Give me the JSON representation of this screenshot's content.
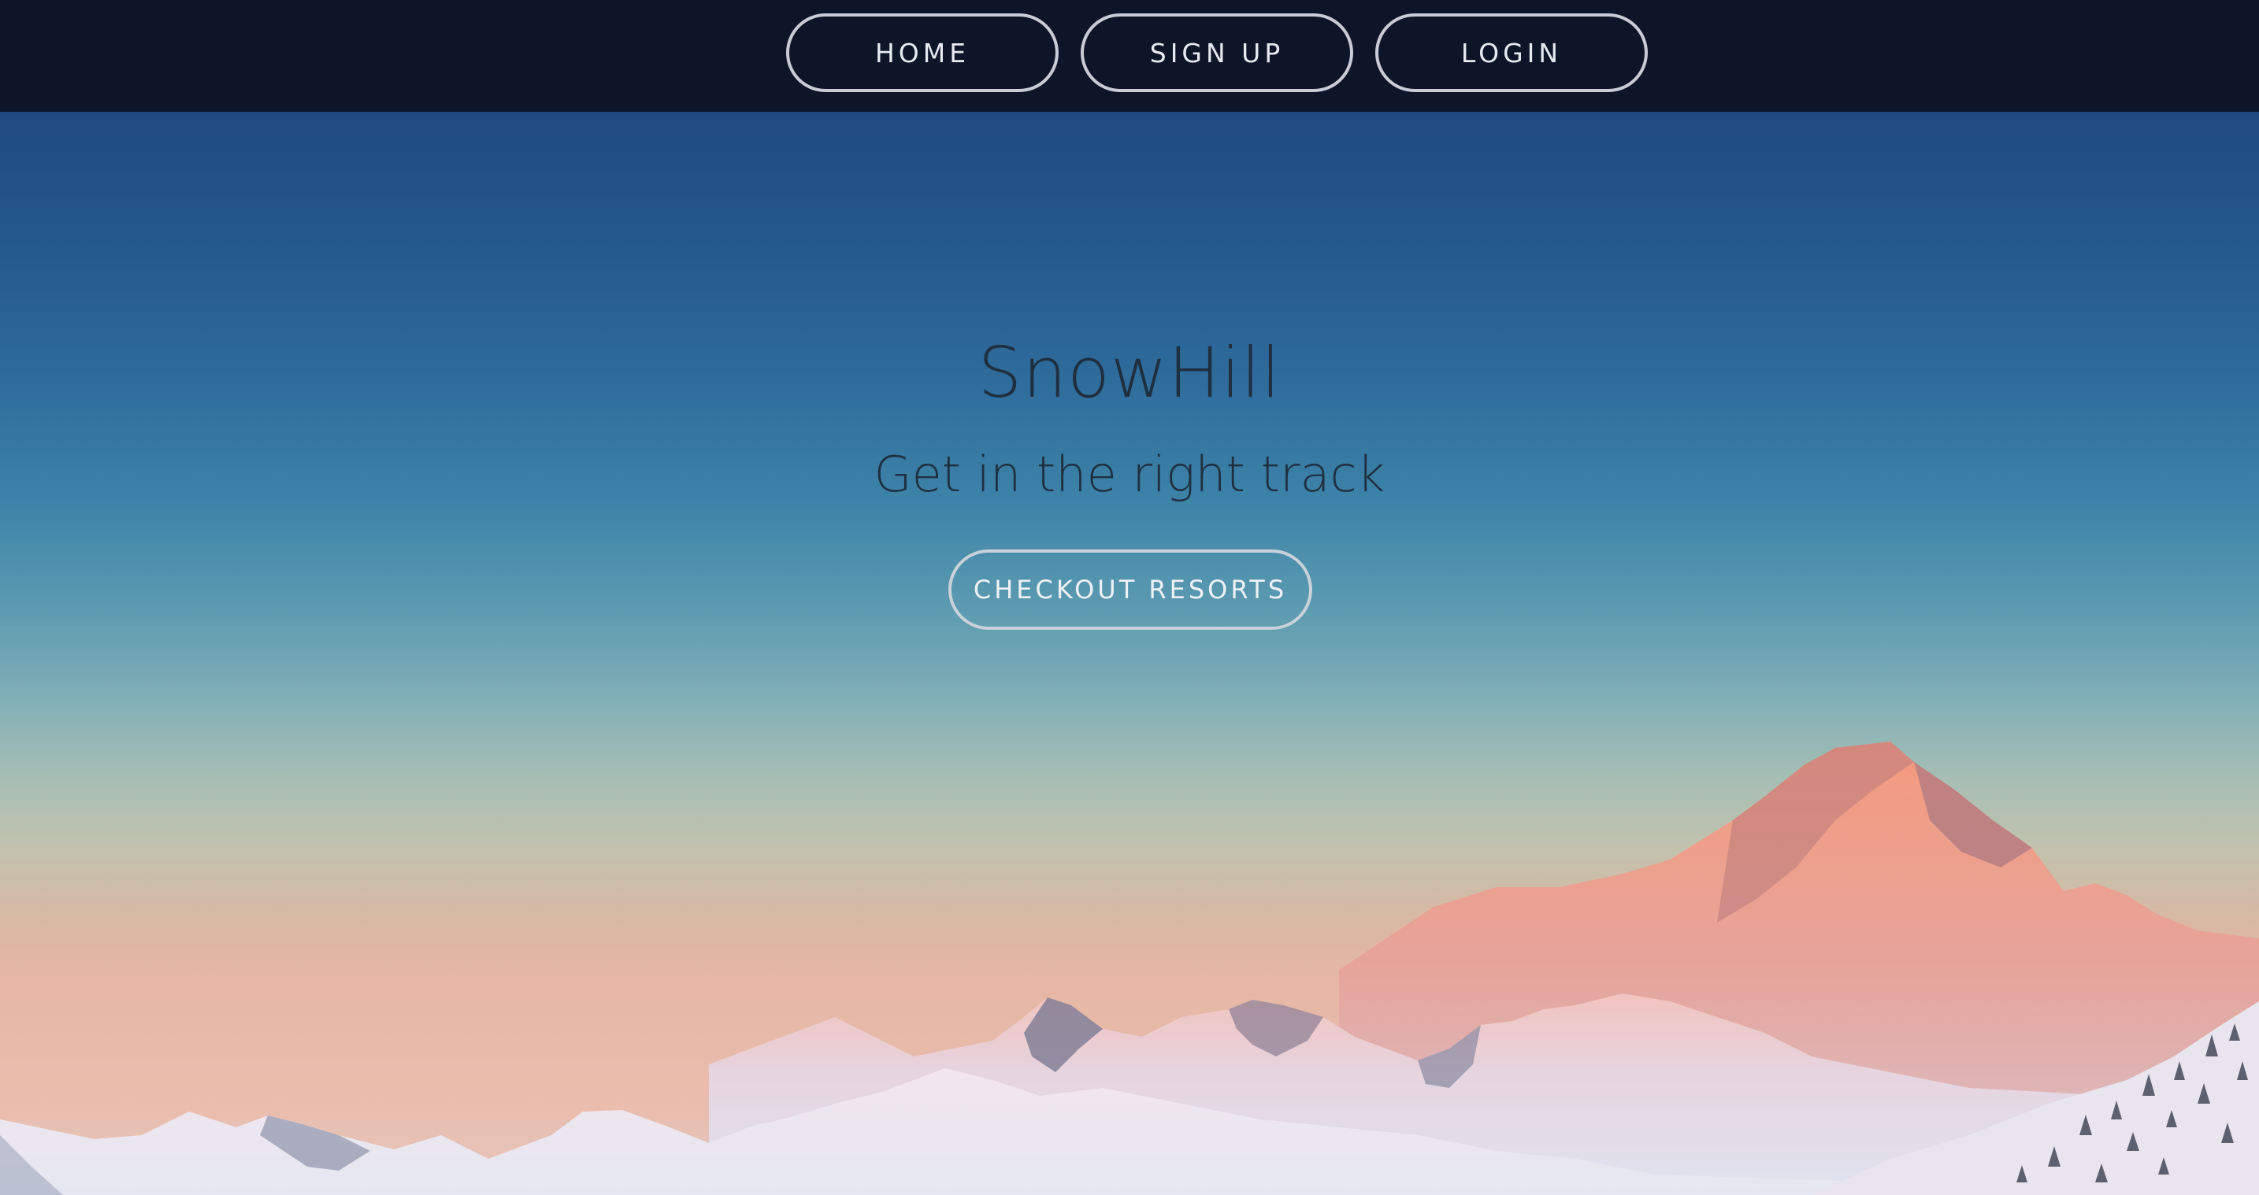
{
  "nav": {
    "home_label": "HOME",
    "signup_label": "SIGN UP",
    "login_label": "LOGIN"
  },
  "hero": {
    "title": "SnowHill",
    "subtitle": "Get in the right track",
    "cta_label": "CHECKOUT RESORTS"
  },
  "colors": {
    "navbar_bg": "#0e1528",
    "sky_top": "#1f4a80",
    "sky_horizon": "#e3b6a3",
    "text_dark": "#1f2f40",
    "button_border": "#c9ccd6"
  }
}
